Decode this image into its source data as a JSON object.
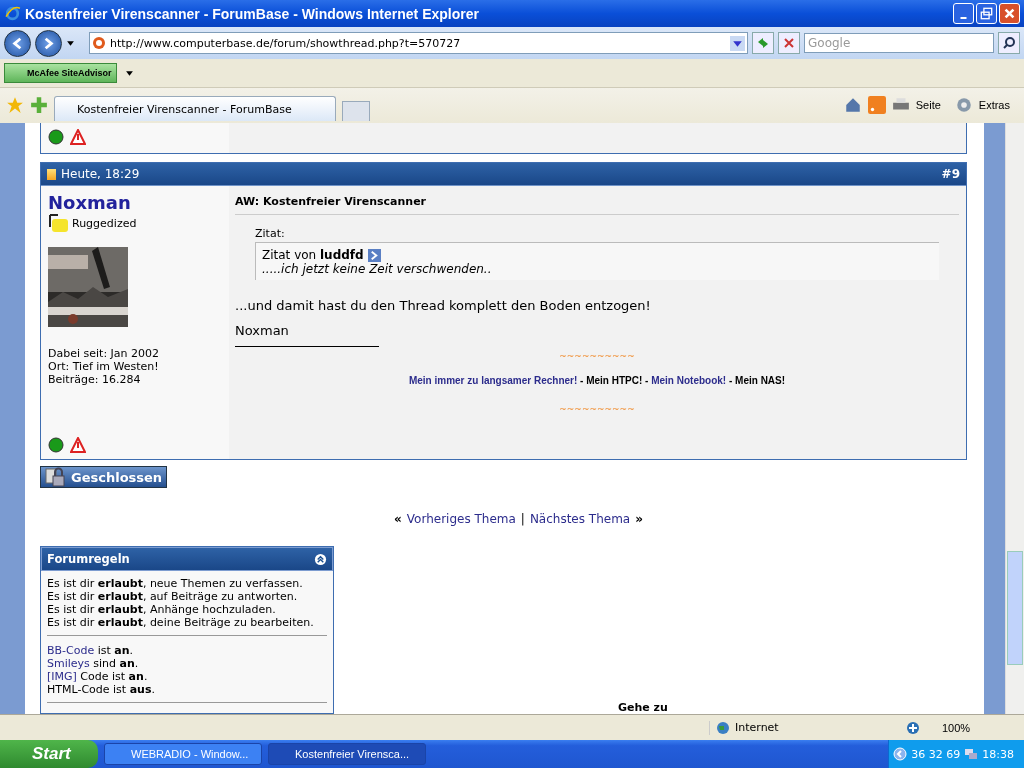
{
  "window": {
    "title": "Kostenfreier Virenscanner - ForumBase - Windows Internet Explorer"
  },
  "address_bar": {
    "url": "http://www.computerbase.de/forum/showthread.php?t=570727",
    "search_placeholder": "Google"
  },
  "addon_toolbar": {
    "label": "McAfee SiteAdvisor"
  },
  "tabs": [
    {
      "label": "Kostenfreier Virenscanner - ForumBase",
      "selected": true
    }
  ],
  "command_bar": [
    "Seite",
    "Extras"
  ],
  "post": {
    "date": "Heute, 18:29",
    "number": "#9",
    "author": "Noxman",
    "rank": "Ruggedized",
    "user_info": [
      "Dabei seit: Jan 2002",
      "Ort: Tief im Westen!",
      "Beiträge: 16.284"
    ],
    "title": "AW: Kostenfreier Virenscanner",
    "quote": {
      "label": "Zitat:",
      "from_prefix": "Zitat von",
      "from": "luddfd",
      "text": ".....ich jetzt keine Zeit verschwenden.."
    },
    "body": "...und damit hast du den Thread komplett den Boden entzogen!",
    "signature_name": "Noxman",
    "signature_ornaments": [
      "~~~~~~~~~~",
      "~~~~~~~~~~"
    ],
    "signature_parts": [
      {
        "kind": "link",
        "text": "Mein immer zu langsamer Rechner!"
      },
      {
        "kind": "plain",
        "text": " - Mein HTPC! - "
      },
      {
        "kind": "link",
        "text": "Mein Notebook!"
      },
      {
        "kind": "plain",
        "text": " - Mein NAS!"
      }
    ]
  },
  "closed_button": "Geschlossen",
  "thread_nav": {
    "left": "«",
    "prev": "Vorheriges Thema",
    "separator": "|",
    "next": "Nächstes Thema",
    "right": "»"
  },
  "forum_rules": {
    "title": "Forumregeln",
    "permissions": [
      "Es ist dir **erlaubt**, neue Themen zu verfassen.",
      "Es ist dir **erlaubt**, auf Beiträge zu antworten.",
      "Es ist dir **erlaubt**, Anhänge hochzuladen.",
      "Es ist dir **erlaubt**, deine Beiträge zu bearbeiten."
    ],
    "codes": [
      {
        "kind": "link",
        "link": "BB-Code",
        "rest": "ist **an**."
      },
      {
        "kind": "link",
        "link": "Smileys",
        "rest": "sind **an**."
      },
      {
        "kind": "link",
        "link": "[IMG]",
        "rest": "Code ist **an**."
      },
      {
        "kind": "plain",
        "rest": "HTML-Code ist **aus**."
      }
    ]
  },
  "goto_label": "Gehe zu",
  "status_bar": {
    "zone": "Internet",
    "zoom": "100%"
  },
  "taskbar": {
    "start": "Start",
    "tasks": [
      {
        "label": "WEBRADIO - Window...",
        "selected": false
      },
      {
        "label": "Kostenfreier Virensca...",
        "selected": true
      }
    ],
    "tray_text": "36 32 69",
    "clock": "18:38"
  }
}
